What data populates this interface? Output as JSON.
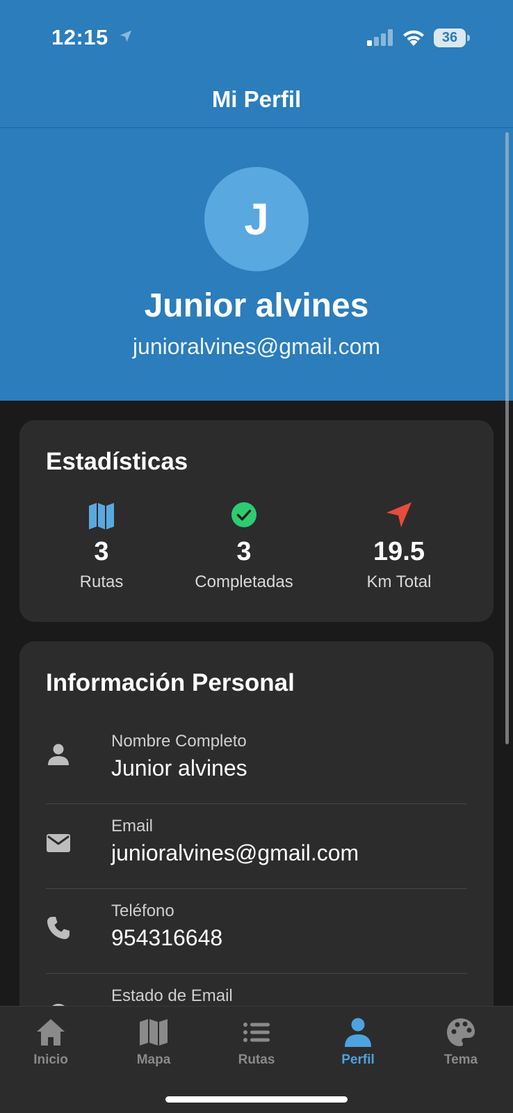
{
  "status_bar": {
    "time": "12:15",
    "battery": "36"
  },
  "header": {
    "title": "Mi Perfil"
  },
  "profile": {
    "initial": "J",
    "name": "Junior alvines",
    "email": "junioralvines@gmail.com"
  },
  "stats": {
    "title": "Estadísticas",
    "items": [
      {
        "icon": "map-icon",
        "value": "3",
        "label": "Rutas",
        "color": "#5aa8e0"
      },
      {
        "icon": "check-circle-icon",
        "value": "3",
        "label": "Completadas",
        "color": "#2ecc71"
      },
      {
        "icon": "navigation-arrow-icon",
        "value": "19.5",
        "label": "Km Total",
        "color": "#e74c3c"
      }
    ]
  },
  "personal_info": {
    "title": "Información Personal",
    "rows": [
      {
        "icon": "person-icon",
        "label": "Nombre Completo",
        "value": "Junior alvines"
      },
      {
        "icon": "mail-icon",
        "label": "Email",
        "value": "junioralvines@gmail.com"
      },
      {
        "icon": "phone-icon",
        "label": "Teléfono",
        "value": "954316648"
      },
      {
        "icon": "verified-icon",
        "label": "Estado de Email",
        "value": ""
      }
    ]
  },
  "tabbar": {
    "active": "Perfil",
    "active_color": "#4da3e0",
    "items": [
      {
        "icon": "home-icon",
        "label": "Inicio"
      },
      {
        "icon": "map-icon",
        "label": "Mapa"
      },
      {
        "icon": "list-icon",
        "label": "Rutas"
      },
      {
        "icon": "person-icon",
        "label": "Perfil"
      },
      {
        "icon": "palette-icon",
        "label": "Tema"
      }
    ]
  },
  "colors": {
    "header_blue": "#2b7dbb",
    "avatar_blue": "#5aa8e0",
    "card": "#2c2c2c",
    "background": "#1a1a1a"
  }
}
